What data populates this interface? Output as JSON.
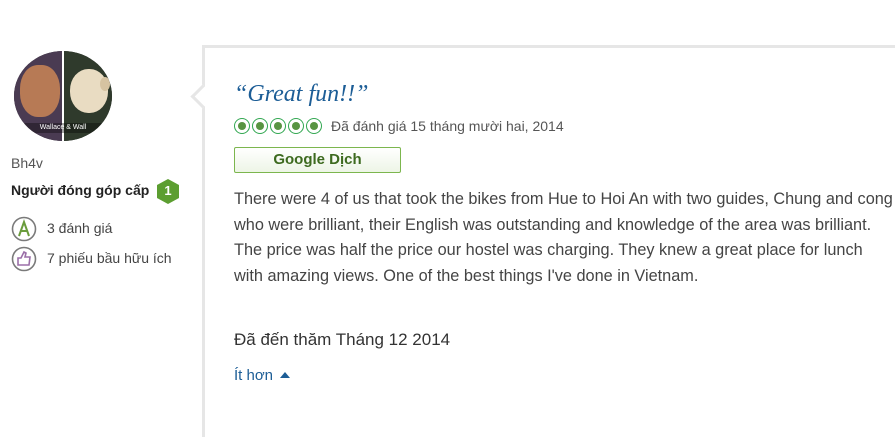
{
  "reviewer": {
    "avatar_caption": "Wallace & Wall",
    "username": "Bh4v",
    "contributor_label": "Người đóng góp cấp",
    "level": "1",
    "review_count": "3 đánh giá",
    "helpful_votes": "7 phiếu bầu hữu ích"
  },
  "review": {
    "title": "“Great fun!!”",
    "rating": 5,
    "rating_max": 5,
    "rated_date": "Đã đánh giá 15 tháng mười hai, 2014",
    "translate_button": "Google Dịch",
    "body": "There were 4 of us that took the bikes from Hue to Hoi An with two guides, Chung and cong who were brilliant, their English was outstanding and knowledge of the area was brilliant. The price was half the price our hostel was charging. They knew a great place for lunch with amazing views. One of the best things I've done in Vietnam.",
    "visited": "Đã đến thăm Tháng 12 2014",
    "less_link": "Ít hơn"
  },
  "colors": {
    "title_blue": "#1c5d96",
    "bubble_green": "#589442",
    "badge_green": "#5c9e31"
  }
}
